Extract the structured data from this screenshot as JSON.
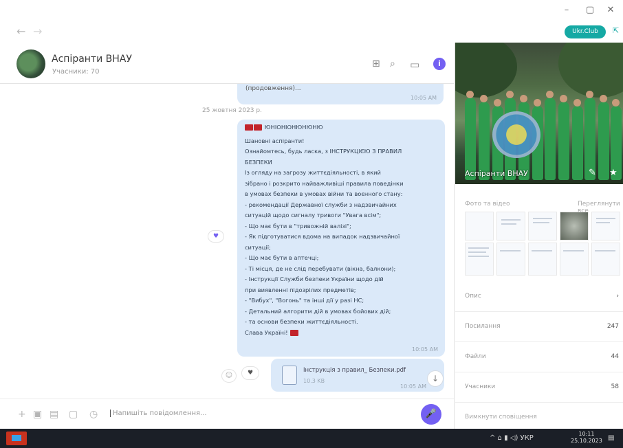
{
  "window": {
    "minimize": "–",
    "maximize": "▢",
    "close": "✕"
  },
  "toolbar": {
    "back": "←",
    "forward": "→",
    "status_pill": "Ukr.Club"
  },
  "chat": {
    "title": "Аспіранти ВНАУ",
    "subtitle": "Учасники: 70"
  },
  "messages": {
    "top_bubble_text": "(продовження)...",
    "top_bubble_time": "10:05 AM",
    "date_separator": "25 жовтня 2023 р.",
    "main_lines": [
      "ЮНІОНІОНЮНЮНЮ",
      "Шановні аспіранти!",
      "Ознайомтесь, будь ласка, з ІНСТРУКЦІЄЮ З ПРАВИЛ",
      "БЕЗПЕКИ",
      "Із огляду на загрозу життєдіяльності, в який",
      "зібрано і розкрито найважливіші правила поведінки",
      "в умовах безпеки в умовах війни та воєнного стану:",
      "- рекомендації Державної служби з надзвичайних",
      "ситуацій щодо сигналу тривоги \"Увага всім\";",
      "- Що має бути в \"тривожній валізі\";",
      "- Як підготуватися вдома на випадок надзвичайної",
      "ситуації;",
      "- Що має бути в аптечці;",
      "- Ті місця, де не слід перебувати (вікна, балкони);",
      "- Інструкції Служби безпеки України щодо дій",
      "при виявленні підозрілих предметів;",
      "- \"Вибух\", \"Вогонь\" та інші дії у разі НС;",
      "- Детальний алгоритм дій в умовах бойових дій;",
      "- та основи безпеки життєдіяльності.",
      "Слава Україні!"
    ],
    "main_time": "10:05 AM",
    "reaction_heart": "♥",
    "file_name": "Інструкція з правил_ Безпеки.pdf",
    "file_size": "10.3 KB",
    "file_time": "10:05 AM",
    "emoji_react": "☺",
    "heart_react": "♥"
  },
  "composer": {
    "placeholder": "Напишіть повідомлення...",
    "mic_icon": "🎤"
  },
  "panel": {
    "group_name": "Аспіранти ВНАУ",
    "media_label": "Фото та відео",
    "media_all": "Переглянути все",
    "rows": [
      {
        "label": "Опис",
        "value": "›"
      },
      {
        "label": "Посилання",
        "value": "247"
      },
      {
        "label": "Файли",
        "value": "44"
      },
      {
        "label": "Учасники",
        "value": "58"
      }
    ],
    "footer_label": "Вимкнути сповіщення"
  },
  "taskbar": {
    "tray": "^  ⌂  ▮  ◁)  УКР",
    "time": "10:11",
    "date": "25.10.2023"
  },
  "colors": {
    "accent": "#7360f2",
    "bubble": "#dbe9f9",
    "teal_pill": "#15a9a4",
    "taskbar": "#1b1f27"
  }
}
